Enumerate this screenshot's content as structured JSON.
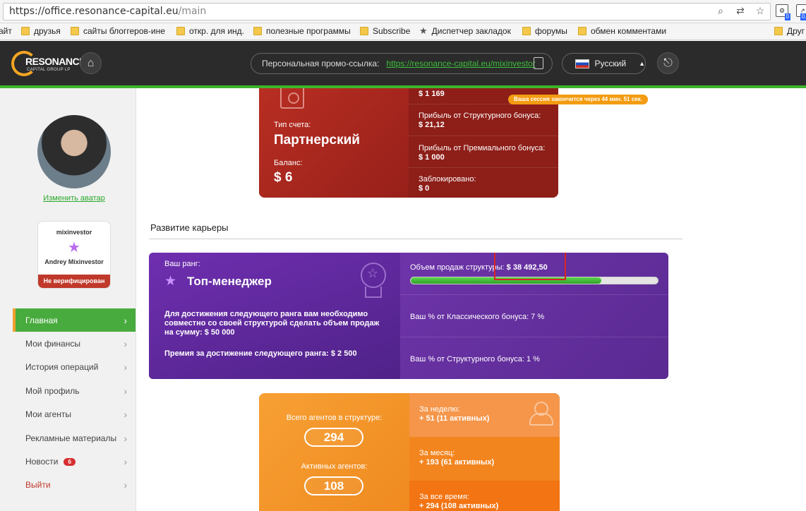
{
  "browser": {
    "url_main": "https://office.resonance-capital.eu",
    "url_path": "/main",
    "ext_badge_1": "0",
    "ext_badge_2": "0.1",
    "bookmarks": [
      {
        "label": "айт",
        "type": "text"
      },
      {
        "label": "друзья",
        "type": "folder"
      },
      {
        "label": "сайты блоггеров-ине",
        "type": "folder"
      },
      {
        "label": "откр. для инд.",
        "type": "folder"
      },
      {
        "label": "полезные программы",
        "type": "folder"
      },
      {
        "label": "Subscribe",
        "type": "folder"
      },
      {
        "label": "Диспетчер закладок",
        "type": "star"
      },
      {
        "label": "форумы",
        "type": "folder"
      },
      {
        "label": "обмен комментами",
        "type": "folder"
      },
      {
        "label": "Друг",
        "type": "folder"
      }
    ]
  },
  "header": {
    "logo_main": "RESONANCE",
    "logo_sub": "CAPITAL GROUP LP",
    "promo_label": "Персональная промо-ссылка:",
    "promo_link": "https://resonance-capital.eu/mixinvestor",
    "language": "Русский",
    "session_notice": "Ваша сессия закончится через 44 мин. 51 сек."
  },
  "sidebar": {
    "change_avatar": "Изменить аватар",
    "login": "mixinvestor",
    "full_name": "Andrey Mixinvestor",
    "verification": "Не верифицирован",
    "menu": [
      {
        "label": "Главная",
        "active": true
      },
      {
        "label": "Мои финансы"
      },
      {
        "label": "История операций"
      },
      {
        "label": "Мой профиль"
      },
      {
        "label": "Мои агенты"
      },
      {
        "label": "Рекламные материалы"
      },
      {
        "label": "Новости",
        "badge": "6"
      },
      {
        "label": "Выйти",
        "exit": true
      }
    ]
  },
  "account": {
    "type_label": "Тип счета:",
    "type_value": "Партнерский",
    "balance_label": "Баланс:",
    "balance_value": "$ 6",
    "top_value": "$ 1 169",
    "structural_label": "Прибыль от Структурного бонуса:",
    "structural_value": "$ 21,12",
    "premium_label": "Прибыль от Премиального бонуса:",
    "premium_value": "$ 1 000",
    "blocked_label": "Заблокировано:",
    "blocked_value": "$ 0"
  },
  "career": {
    "title": "Развитие карьеры",
    "rank_label": "Ваш ранг:",
    "rank_name": "Топ-менеджер",
    "next_text": "Для достижения следующего ранга вам необходимо совместно со своей структурой сделать объем продаж на сумму: $ 50 000",
    "bonus_text": "Премия за достижение следующего ранга: $ 2 500",
    "volume_label": "Объем продаж структуры:",
    "volume_value": "$ 38 492,50",
    "progress_fraction": 0.77,
    "classic_text": "Ваш % от Классического бонуса: 7 %",
    "structural_text": "Ваш % от Структурного бонуса: 1 %"
  },
  "agents": {
    "total_label": "Всего агентов в структуре:",
    "total_value": "294",
    "active_label": "Активных агентов:",
    "active_value": "108",
    "week_label": "За неделю:",
    "week_value": "+ 51 (11 активных)",
    "month_label": "За месяц:",
    "month_value": "+ 193 (61 активных)",
    "all_label": "За все время:",
    "all_value": "+ 294 (108 активных)"
  }
}
